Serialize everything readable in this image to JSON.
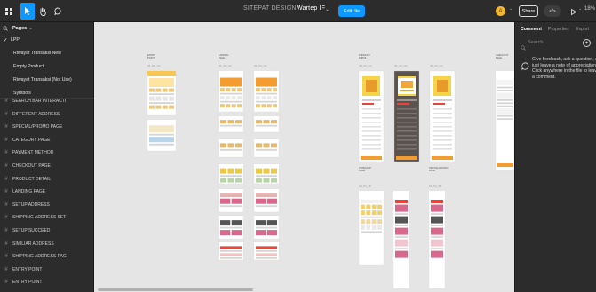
{
  "toolbar": {
    "project": "SITEPAT DESIGN",
    "separator": "/",
    "file": "Wartep IF",
    "file_caret": "⌄",
    "edit_button": "Edit file",
    "avatar_initial": "A",
    "share_button": "Share",
    "code_button": "</>",
    "zoom": "18%",
    "icons": [
      "figma-menu-icon",
      "move-tool-icon",
      "hand-tool-icon",
      "comment-tool-icon",
      "play-icon"
    ]
  },
  "sidebar": {
    "pages_heading": "Pages",
    "pages": [
      {
        "label": "LPP",
        "active": true
      },
      {
        "label": "Riwayat Transaksi New",
        "active": false
      },
      {
        "label": "Empty Product",
        "active": false
      },
      {
        "label": "Riwayat Transaksi (Not Use)",
        "active": false
      },
      {
        "label": "Symbols",
        "active": false
      }
    ],
    "layers": [
      "SEARCH BAR INTERACTI",
      "DIFFERENT ADDRESS",
      "SPECIAL/PROMO PAGE",
      "CATEGORY PAGE",
      "PAYMENT METHOD",
      "CHECKOUT PAGE",
      "PRODUCT DETAIL",
      "LANDING PAGE",
      "SETUP ADDRESS",
      "SHIPPING ADDRESS SET",
      "SETUP SUCCEED",
      "SIMILIAR ADDRESS",
      "SHIPPING ADDRESS PAG",
      "ENTRY POINT",
      "ENTRY POINT"
    ]
  },
  "canvas": {
    "background": "#e5e5e5",
    "sections": [
      {
        "label": "ENTRY\nPOINT",
        "frame": "01_EP_Ho"
      },
      {
        "label": "LANDING\nPAGE",
        "frame": "01_OC_Ho"
      },
      {
        "label": "",
        "frame": "01_O1_Ho"
      },
      {
        "label": "PRODUCT\nDETAIL",
        "frame": "01_O1_Ho"
      },
      {
        "label": "",
        "frame": "01_O1_Ho"
      },
      {
        "label": "",
        "frame": "01_O1_Ho"
      },
      {
        "label": "CHECKOUT\nPAGE",
        "frame": ""
      },
      {
        "label": "CATEGORY\nPAGE",
        "frame": "01_O1_Bt"
      },
      {
        "label": "SPECIAL/PROMO\nPAGE",
        "frame": "01_O1_Bt"
      }
    ]
  },
  "right_panel": {
    "tabs": [
      "Comment",
      "Properties",
      "Export"
    ],
    "search_placeholder": "Search",
    "add_icon": "+",
    "hint": "Give feedback, ask a question, or\njust leave a note of appreciation.\nClick anywhere in the file to leave\na comment."
  },
  "colors": {
    "accent": "#0d99ff",
    "ui_dark": "#2c2c2c",
    "orange": "#f39c32",
    "yellow": "#f5d547",
    "red": "#e8453c"
  }
}
